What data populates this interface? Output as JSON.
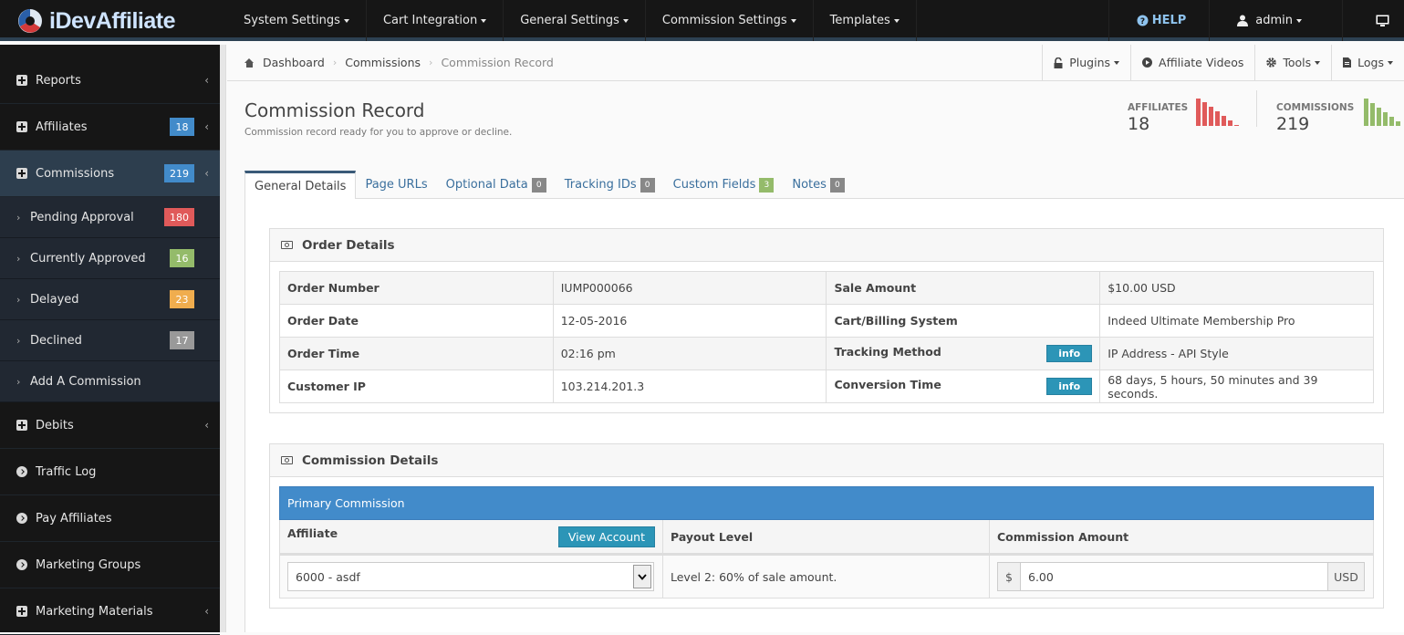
{
  "brand": {
    "name": "iDevAffiliate"
  },
  "topnav": {
    "items": [
      "System Settings",
      "Cart Integration",
      "General Settings",
      "Commission Settings",
      "Templates"
    ],
    "help": "HELP",
    "user": "admin"
  },
  "sidebar": {
    "reports": "Reports",
    "affiliates": {
      "label": "Affiliates",
      "badge": "18"
    },
    "commissions": {
      "label": "Commissions",
      "badge": "219"
    },
    "sub": [
      {
        "label": "Pending Approval",
        "badge": "180"
      },
      {
        "label": "Currently Approved",
        "badge": "16"
      },
      {
        "label": "Delayed",
        "badge": "23"
      },
      {
        "label": "Declined",
        "badge": "17"
      },
      {
        "label": "Add A Commission"
      }
    ],
    "debits": "Debits",
    "traffic_log": "Traffic Log",
    "pay_affiliates": "Pay Affiliates",
    "marketing_groups": "Marketing Groups",
    "marketing_materials": "Marketing Materials"
  },
  "colors": {
    "blue": "#428bca",
    "red": "#e05a5a",
    "green": "#94bb6a",
    "orange": "#f0ad4e",
    "gray": "#999999",
    "teal": "#2c95b7"
  },
  "breadcrumb": {
    "home": "Dashboard",
    "parent": "Commissions",
    "current": "Commission Record"
  },
  "toolbar": {
    "plugins": "Plugins",
    "videos": "Affiliate Videos",
    "tools": "Tools",
    "logs": "Logs"
  },
  "page": {
    "title": "Commission Record",
    "subtitle": "Commission record ready for you to approve or decline."
  },
  "stats": {
    "affiliates": {
      "label": "AFFILIATES",
      "value": "18"
    },
    "commissions": {
      "label": "COMMISSIONS",
      "value": "219"
    }
  },
  "tabs": [
    {
      "label": "General Details"
    },
    {
      "label": "Page URLs"
    },
    {
      "label": "Optional Data",
      "badge": "0"
    },
    {
      "label": "Tracking IDs",
      "badge": "0"
    },
    {
      "label": "Custom Fields",
      "badge": "3"
    },
    {
      "label": "Notes",
      "badge": "0"
    }
  ],
  "order": {
    "title": "Order Details",
    "info_label": "info",
    "rows": [
      {
        "k1": "Order Number",
        "v1": "IUMP000066",
        "k2": "Sale Amount",
        "v2": "$10.00 USD"
      },
      {
        "k1": "Order Date",
        "v1": "12-05-2016",
        "k2": "Cart/Billing System",
        "v2": "Indeed Ultimate Membership Pro"
      },
      {
        "k1": "Order Time",
        "v1": "02:16 pm",
        "k2": "Tracking Method",
        "v2": "IP Address - API Style"
      },
      {
        "k1": "Customer IP",
        "v1": "103.214.201.3",
        "k2": "Conversion Time",
        "v2": "68 days, 5 hours, 50 minutes and 39 seconds."
      }
    ]
  },
  "commission": {
    "title": "Commission Details",
    "primary": "Primary Commission",
    "col_affiliate": "Affiliate",
    "view_account": "View Account",
    "col_payout": "Payout Level",
    "col_amount": "Commission Amount",
    "affiliate_selected": "6000 - asdf",
    "payout_level": "Level 2: 60% of sale amount.",
    "currency_symbol": "$",
    "amount": "6.00",
    "currency": "USD"
  }
}
